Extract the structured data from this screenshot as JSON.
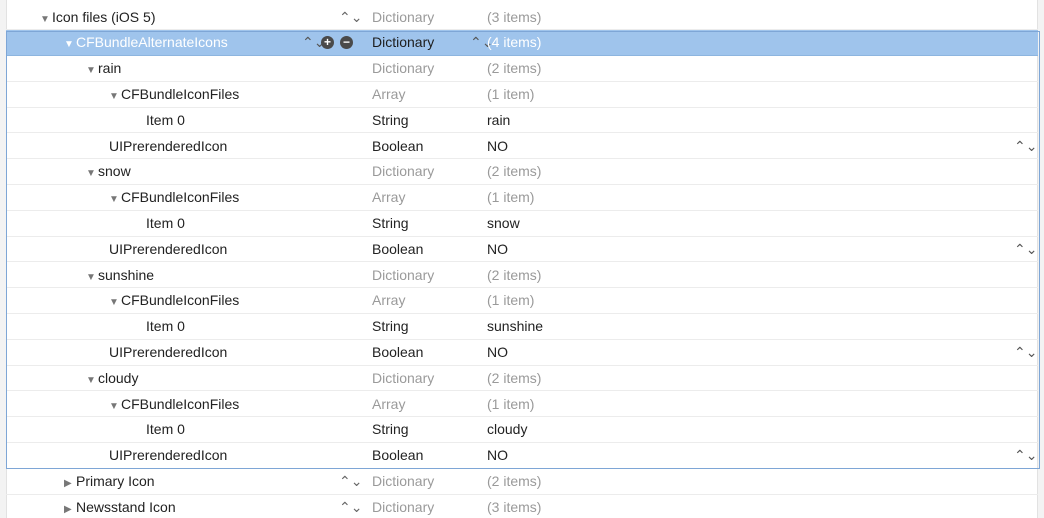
{
  "rows": [
    {
      "key": "Icon files (iOS 5)",
      "type": "Dictionary",
      "value": "(3 items)",
      "disclosure": "▼",
      "indent": 1,
      "dim": true,
      "key_stepper": true
    },
    {
      "key": "CFBundleAlternateIcons",
      "type": "Dictionary",
      "value": "(4 items)",
      "disclosure": "▼",
      "indent": 2,
      "selected": true,
      "key_stepper": true,
      "buttons": true,
      "type_stepper": true
    },
    {
      "key": "rain",
      "type": "Dictionary",
      "value": "(2 items)",
      "disclosure": "▼",
      "indent": 3,
      "dim": true
    },
    {
      "key": "CFBundleIconFiles",
      "type": "Array",
      "value": "(1 item)",
      "disclosure": "▼",
      "indent": 4,
      "dim": true
    },
    {
      "key": "Item 0",
      "type": "String",
      "value": "rain",
      "indent": 5
    },
    {
      "key": "UIPrerenderedIcon",
      "type": "Boolean",
      "value": "NO",
      "indent": 4,
      "value_stepper": true
    },
    {
      "key": "snow",
      "type": "Dictionary",
      "value": "(2 items)",
      "disclosure": "▼",
      "indent": 3,
      "dim": true
    },
    {
      "key": "CFBundleIconFiles",
      "type": "Array",
      "value": "(1 item)",
      "disclosure": "▼",
      "indent": 4,
      "dim": true
    },
    {
      "key": "Item 0",
      "type": "String",
      "value": "snow",
      "indent": 5
    },
    {
      "key": "UIPrerenderedIcon",
      "type": "Boolean",
      "value": "NO",
      "indent": 4,
      "value_stepper": true
    },
    {
      "key": "sunshine",
      "type": "Dictionary",
      "value": "(2 items)",
      "disclosure": "▼",
      "indent": 3,
      "dim": true
    },
    {
      "key": "CFBundleIconFiles",
      "type": "Array",
      "value": "(1 item)",
      "disclosure": "▼",
      "indent": 4,
      "dim": true
    },
    {
      "key": "Item 0",
      "type": "String",
      "value": "sunshine",
      "indent": 5
    },
    {
      "key": "UIPrerenderedIcon",
      "type": "Boolean",
      "value": "NO",
      "indent": 4,
      "value_stepper": true
    },
    {
      "key": "cloudy",
      "type": "Dictionary",
      "value": "(2 items)",
      "disclosure": "▼",
      "indent": 3,
      "dim": true
    },
    {
      "key": "CFBundleIconFiles",
      "type": "Array",
      "value": "(1 item)",
      "disclosure": "▼",
      "indent": 4,
      "dim": true
    },
    {
      "key": "Item 0",
      "type": "String",
      "value": "cloudy",
      "indent": 5
    },
    {
      "key": "UIPrerenderedIcon",
      "type": "Boolean",
      "value": "NO",
      "indent": 4,
      "value_stepper": true
    },
    {
      "key": "Primary Icon",
      "type": "Dictionary",
      "value": "(2 items)",
      "disclosure": "▶",
      "indent": 2,
      "dim": true,
      "key_stepper": true
    },
    {
      "key": "Newsstand Icon",
      "type": "Dictionary",
      "value": "(3 items)",
      "disclosure": "▶",
      "indent": 2,
      "dim": true,
      "key_stepper": true
    }
  ],
  "glyphs": {
    "stepper": "⌃⌄",
    "add": "+",
    "remove": "−"
  },
  "icons": {
    "expanded": "disclosure-expanded-icon",
    "collapsed": "disclosure-collapsed-icon",
    "stepper": "up-down-stepper-icon",
    "add": "add-circle-icon",
    "remove": "remove-circle-icon"
  },
  "colors": {
    "selection": "#9fc4ec",
    "group_outline": "#7ea6d6",
    "dim_text": "#9a9a9a"
  }
}
